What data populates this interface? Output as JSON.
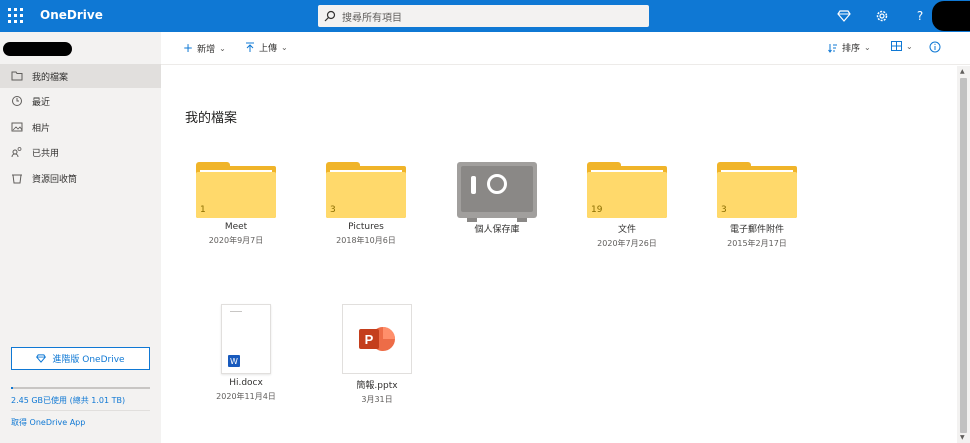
{
  "app": {
    "brand": "OneDrive"
  },
  "search": {
    "placeholder": "搜尋所有項目"
  },
  "header": {
    "help": "?"
  },
  "leftnav": {
    "items": [
      {
        "label": "我的檔案",
        "icon": "folder-icon",
        "active": true
      },
      {
        "label": "最近",
        "icon": "recent-icon"
      },
      {
        "label": "相片",
        "icon": "photos-icon"
      },
      {
        "label": "已共用",
        "icon": "shared-icon"
      },
      {
        "label": "資源回收筒",
        "icon": "recycle-bin-icon"
      }
    ],
    "premium_label": "進階版 OneDrive",
    "storage_text": "2.45 GB已使用 (總共 1.01 TB)",
    "storage_fraction": 0.0024,
    "get_app": "取得 OneDrive App"
  },
  "commandbar": {
    "new_label": "新增",
    "upload_label": "上傳",
    "sort_label": "排序"
  },
  "main": {
    "title": "我的檔案",
    "items": [
      {
        "type": "folder",
        "name": "Meet",
        "date": "2020年9月7日",
        "count": "1"
      },
      {
        "type": "folder",
        "name": "Pictures",
        "date": "2018年10月6日",
        "count": "3"
      },
      {
        "type": "vault",
        "name": "個人保存庫",
        "date": ""
      },
      {
        "type": "folder",
        "name": "文件",
        "date": "2020年7月26日",
        "count": "19"
      },
      {
        "type": "folder",
        "name": "電子郵件附件",
        "date": "2015年2月17日",
        "count": "3"
      },
      {
        "type": "docx",
        "name": "Hi.docx",
        "date": "2020年11月4日"
      },
      {
        "type": "pptx",
        "name": "簡報.pptx",
        "date": "3月31日"
      }
    ]
  },
  "colors": {
    "accent": "#0f78d4",
    "folder": "#ffd96b",
    "word": "#185abd",
    "powerpoint": "#c43e1c"
  }
}
